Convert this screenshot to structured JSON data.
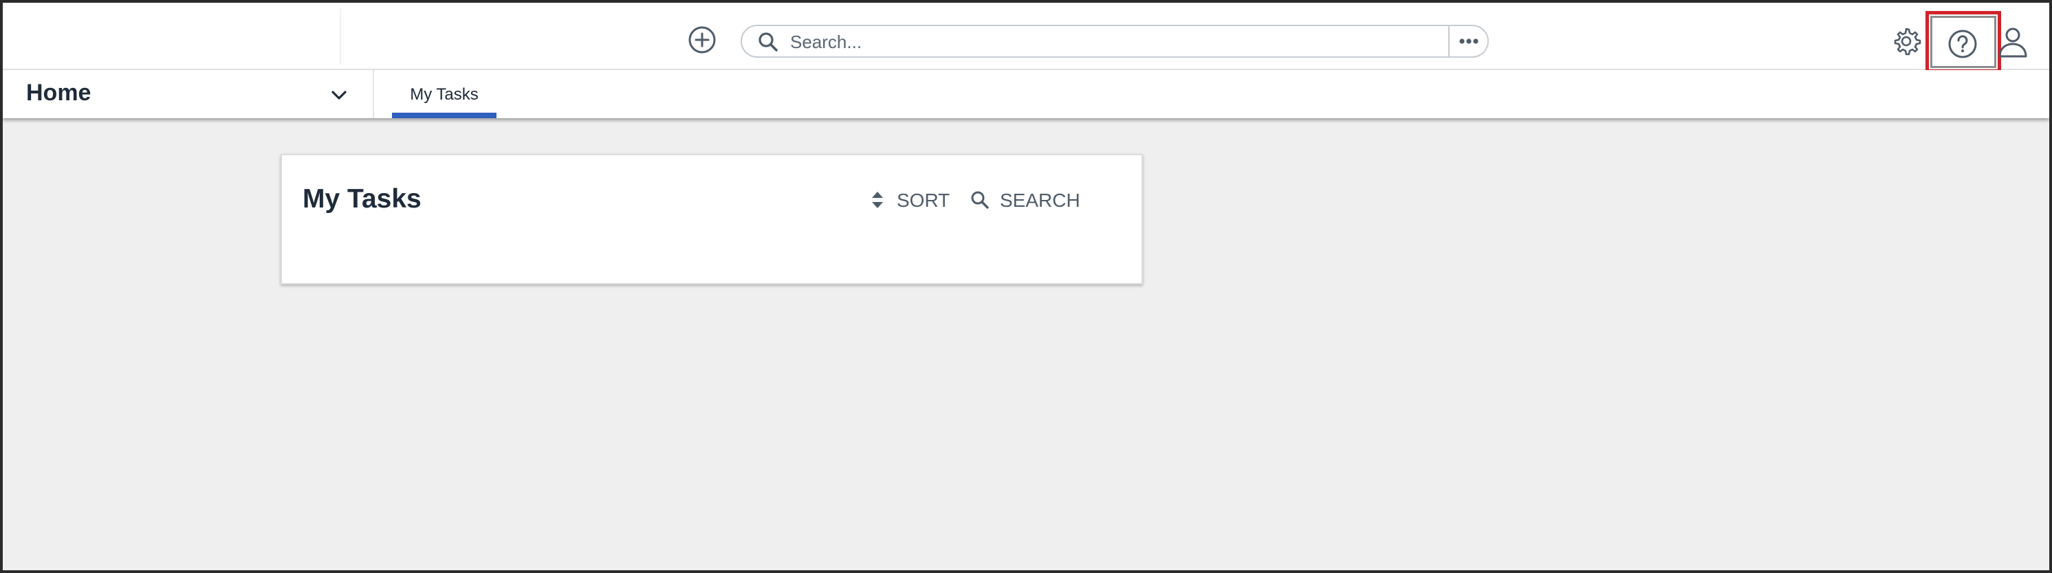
{
  "header": {
    "create_icon": "plus-circle-icon",
    "search": {
      "placeholder": "Search...",
      "value": ""
    },
    "more_icon": "ellipsis-icon",
    "settings_icon": "gear-icon",
    "help_icon": "question-circle-icon",
    "profile_icon": "user-icon",
    "highlight_color": "#d1232a"
  },
  "nav": {
    "workspace_label": "Home",
    "tabs": [
      {
        "label": "My Tasks",
        "active": true
      }
    ],
    "accent_color": "#2f5fbf"
  },
  "card": {
    "title": "My Tasks",
    "sort_label": "SORT",
    "search_label": "SEARCH"
  }
}
